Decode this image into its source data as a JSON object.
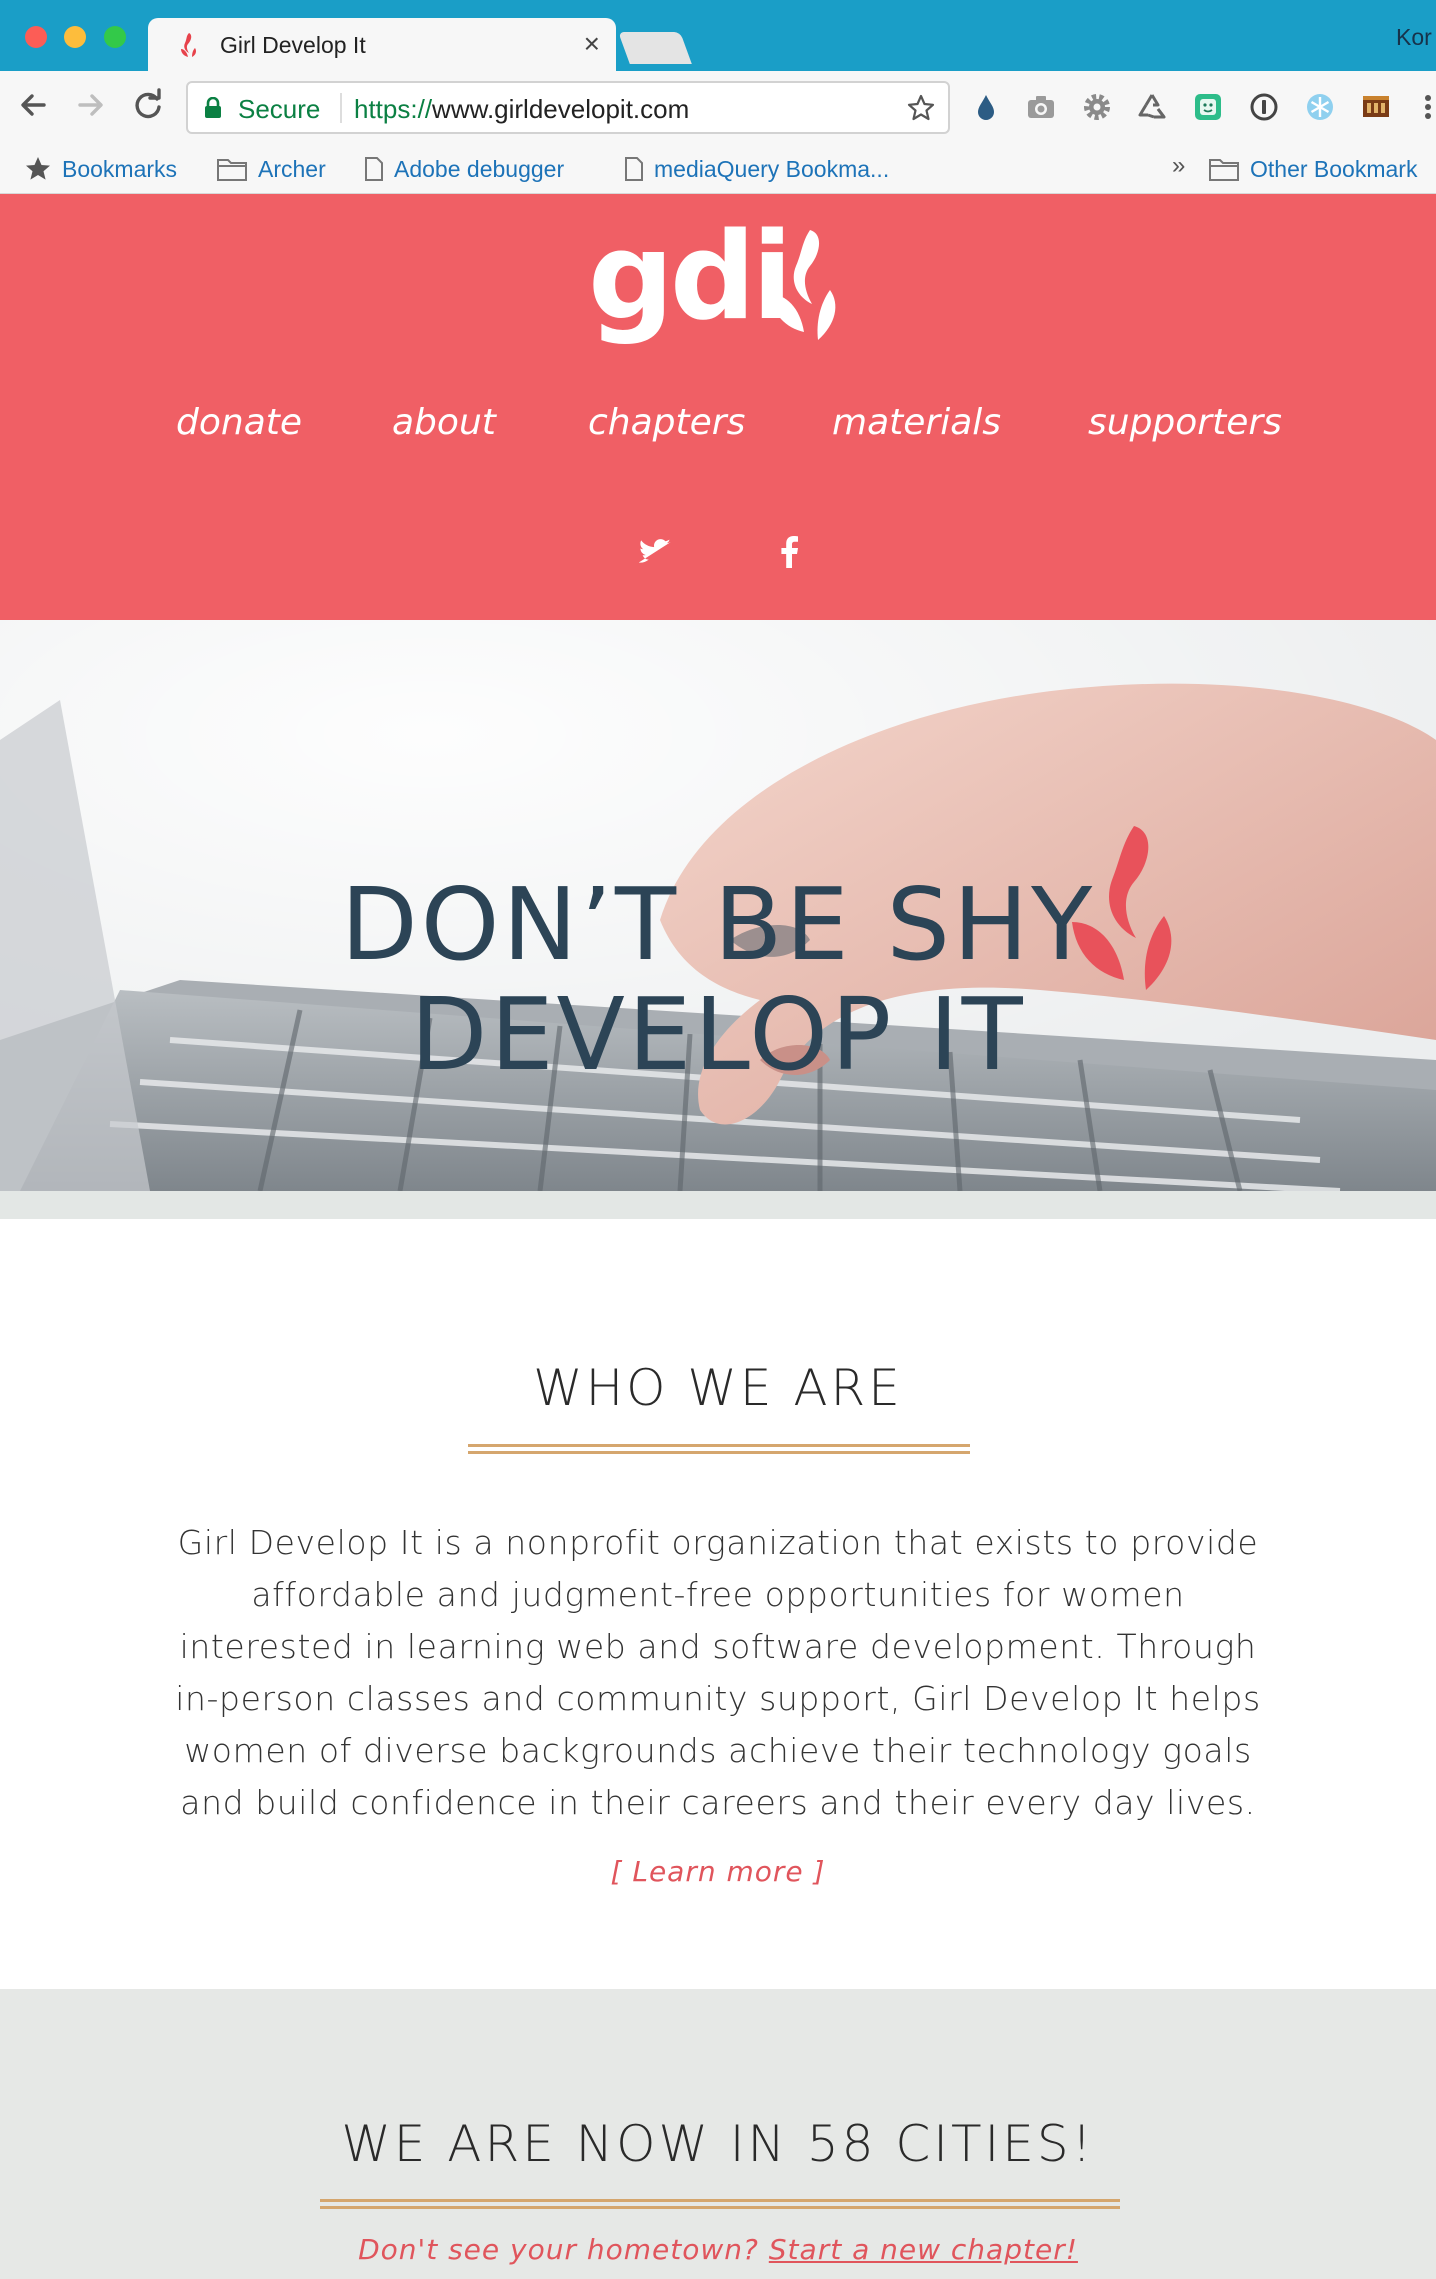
{
  "browser": {
    "tab_title": "Girl Develop It",
    "tab_close": "×",
    "profile_name": "Kor",
    "security_label": "Secure",
    "url_protocol": "https://",
    "url_host": "www.girldevelopit.com",
    "bookmarks": [
      {
        "label": "Bookmarks",
        "icon": "star-icon"
      },
      {
        "label": "Archer",
        "icon": "folder-icon"
      },
      {
        "label": "Adobe debugger",
        "icon": "page-icon"
      },
      {
        "label": "mediaQuery Bookma...",
        "icon": "page-icon"
      },
      {
        "label": "Other Bookmark",
        "icon": "folder-icon"
      }
    ],
    "bookmarks_overflow": "»",
    "extensions": [
      "drop-icon",
      "camera-icon",
      "gear-icon",
      "recycle-icon",
      "face-icon",
      "info-icon",
      "snowflake-icon",
      "film-icon",
      "menu-icon"
    ]
  },
  "site": {
    "logo_text": "gdi",
    "nav": [
      {
        "label": "donate"
      },
      {
        "label": "about"
      },
      {
        "label": "chapters"
      },
      {
        "label": "materials"
      },
      {
        "label": "supporters"
      }
    ],
    "social": [
      "twitter-icon",
      "facebook-icon"
    ],
    "hero": {
      "line1": "DON’T BE SHY",
      "line2": "DEVELOP IT"
    },
    "who": {
      "heading": "WHO WE ARE",
      "body": "Girl Develop It is a nonprofit organization that exists to provide affordable and judgment-free opportunities for women interested in learning web and software development. Through in-person classes and community support, Girl Develop It helps women of diverse backgrounds achieve their technology goals and build confidence in their careers and their every day lives.",
      "learn_more": "[ Learn more ]"
    },
    "cities": {
      "heading": "WE ARE NOW IN 58 CITIES!",
      "sub_prefix": "Don't see your hometown?",
      "sub_link": "Start a new chapter!"
    }
  },
  "colors": {
    "browser_frame": "#1a9ec7",
    "brand_coral": "#f05f65",
    "hero_text": "#2c4456",
    "rule_gold": "#d5a66e",
    "link_red": "#e0555c"
  }
}
